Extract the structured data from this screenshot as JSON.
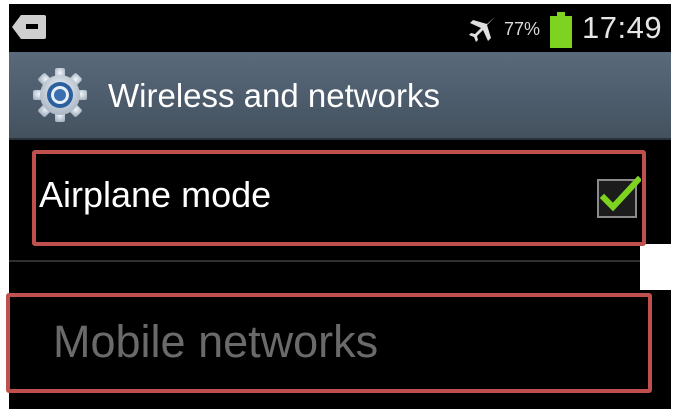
{
  "status_bar": {
    "back_icon": "back-icon",
    "airplane_icon": "airplane-icon",
    "battery_percent": "77%",
    "battery_level": 0.77,
    "time": "17:49"
  },
  "header": {
    "icon": "gear-icon",
    "title": "Wireless and networks"
  },
  "settings": {
    "airplane_mode": {
      "label": "Airplane mode",
      "checked": true
    },
    "mobile_networks": {
      "label": "Mobile networks",
      "enabled": false
    }
  },
  "colors": {
    "highlight": "#c0504d",
    "checkmark": "#7ed321",
    "battery": "#7ed321",
    "disabled_text": "#6a6a6a"
  }
}
